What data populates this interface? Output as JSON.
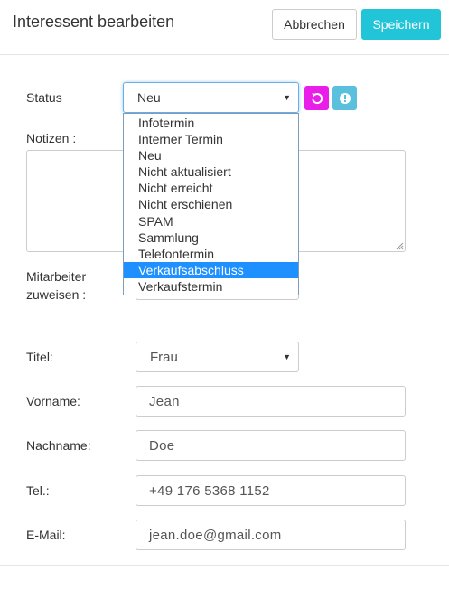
{
  "header": {
    "title": "Interessent bearbeiten",
    "cancel_label": "Abbrechen",
    "save_label": "Speichern"
  },
  "status": {
    "label": "Status",
    "value": "Neu",
    "options": [
      "Infotermin",
      "Interner Termin",
      "Neu",
      "Nicht aktualisiert",
      "Nicht erreicht",
      "Nicht erschienen",
      "SPAM",
      "Sammlung",
      "Telefontermin",
      "Verkaufsabschluss",
      "Verkaufstermin"
    ],
    "highlighted_option": "Verkaufsabschluss",
    "reset_icon": "reset-icon",
    "info_icon": "info-icon"
  },
  "notes": {
    "label": "Notizen :",
    "value": ""
  },
  "employee": {
    "label_line1": "Mitarbeiter",
    "label_line2": "zuweisen :",
    "value": ""
  },
  "form": {
    "title_label": "Titel:",
    "title_value": "Frau",
    "first_name_label": "Vorname:",
    "first_name_value": "Jean",
    "last_name_label": "Nachname:",
    "last_name_value": "Doe",
    "phone_label": "Tel.:",
    "phone_value": "+49 176 5368 1152",
    "email_label": "E-Mail:",
    "email_value": "jean.doe@gmail.com"
  },
  "colors": {
    "save": "#22c4d8",
    "reset": "#e91ee9",
    "info": "#5bc0de",
    "highlight": "#1e90ff"
  }
}
